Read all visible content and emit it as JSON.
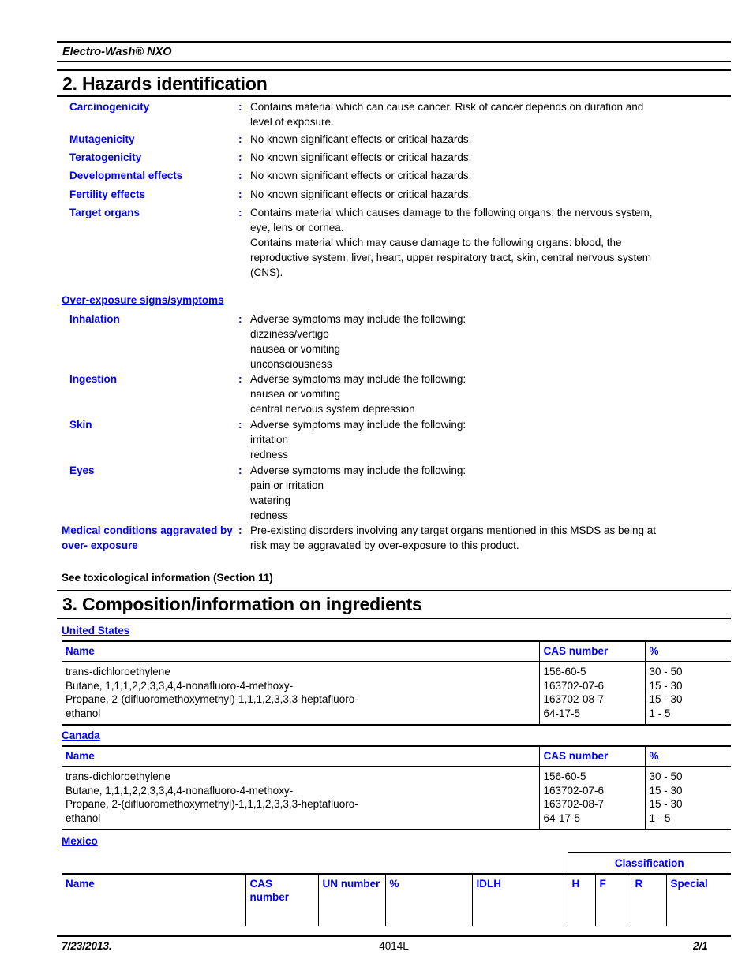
{
  "document": {
    "running_header": "Electro-Wash® NXO"
  },
  "section2": {
    "title": "2. Hazards identification",
    "rows": [
      {
        "label": "Carcinogenicity",
        "colon": ":",
        "lines": [
          "Contains material which can cause cancer.  Risk of cancer depends on duration and",
          "level of exposure."
        ]
      },
      {
        "label": "Mutagenicity",
        "colon": ":",
        "lines": [
          "No known significant effects or critical hazards."
        ]
      },
      {
        "label": "Teratogenicity",
        "colon": ":",
        "lines": [
          "No known significant effects or critical hazards."
        ]
      },
      {
        "label": "Developmental effects",
        "colon": ":",
        "lines": [
          "No known significant effects or critical hazards."
        ]
      },
      {
        "label": "Fertility effects",
        "colon": ":",
        "lines": [
          "No known significant effects or critical hazards."
        ]
      },
      {
        "label": "Target organs",
        "colon": ":",
        "lines": [
          "Contains material which causes damage to the following organs: the nervous system,",
          "eye, lens or cornea.",
          "Contains material which may cause damage to the following organs: blood, the",
          "reproductive system, liver, heart, upper respiratory tract, skin, central nervous system",
          "(CNS)."
        ]
      }
    ],
    "overexposure_heading": "Over-exposure signs/symptoms",
    "overexposure_rows": [
      {
        "label": "Inhalation",
        "colon": ":",
        "lines": [
          "Adverse symptoms may include the following:",
          "dizziness/vertigo",
          "nausea or vomiting",
          "unconsciousness"
        ]
      },
      {
        "label": "Ingestion",
        "colon": ":",
        "lines": [
          "Adverse symptoms may include the following:",
          "nausea or vomiting",
          "central nervous system depression"
        ]
      },
      {
        "label": "Skin",
        "colon": ":",
        "lines": [
          "Adverse symptoms may include the following:",
          "irritation",
          "redness"
        ]
      },
      {
        "label": "Eyes",
        "colon": ":",
        "lines": [
          "Adverse symptoms may include the following:",
          "pain or irritation",
          "watering",
          "redness"
        ]
      }
    ],
    "medical_conditions": {
      "label_lines": [
        "Medical conditions",
        "aggravated by over-",
        "exposure"
      ],
      "colon": ":",
      "lines": [
        "Pre-existing disorders involving any target organs mentioned in this MSDS as being at",
        "risk may be aggravated by over-exposure to this product."
      ]
    },
    "see_toxicological": "See toxicological information (Section 11)"
  },
  "section3": {
    "title": "3. Composition/information on ingredients",
    "united_states": {
      "heading": "United States",
      "columns": [
        "Name",
        "CAS number",
        "%"
      ],
      "names": [
        "trans-dichloroethylene",
        "Butane, 1,1,1,2,2,3,3,4,4-nonafluoro-4-methoxy-",
        "Propane, 2-(difluoromethoxymethyl)-1,1,1,2,3,3,3-heptafluoro-",
        "ethanol"
      ],
      "cas_numbers": [
        "156-60-5",
        "163702-07-6",
        "163702-08-7",
        "64-17-5"
      ],
      "percents": [
        "30 - 50",
        "15 - 30",
        "15 - 30",
        "1 - 5"
      ]
    },
    "canada": {
      "heading": "Canada",
      "columns": [
        "Name",
        "CAS number",
        "%"
      ],
      "names": [
        "trans-dichloroethylene",
        "Butane, 1,1,1,2,2,3,3,4,4-nonafluoro-4-methoxy-",
        "Propane, 2-(difluoromethoxymethyl)-1,1,1,2,3,3,3-heptafluoro-",
        "ethanol"
      ],
      "cas_numbers": [
        "156-60-5",
        "163702-07-6",
        "163702-08-7",
        "64-17-5"
      ],
      "percents": [
        "30 - 50",
        "15 - 30",
        "15 - 30",
        "1 - 5"
      ]
    },
    "mexico": {
      "heading": "Mexico",
      "classification_group": "Classification",
      "columns": {
        "name": "Name",
        "cas_number_line1": "CAS",
        "cas_number_line2": "number",
        "un_number": "UN number",
        "percent": "%",
        "idlh": "IDLH",
        "h": "H",
        "f": "F",
        "r": "R",
        "special": "Special"
      }
    }
  },
  "footer": {
    "date": "7/23/2013.",
    "product_code": "4014L",
    "page": "2/1"
  },
  "colors": {
    "heading_blue": "#0000ff",
    "text_black": "#000000",
    "background": "#ffffff"
  }
}
